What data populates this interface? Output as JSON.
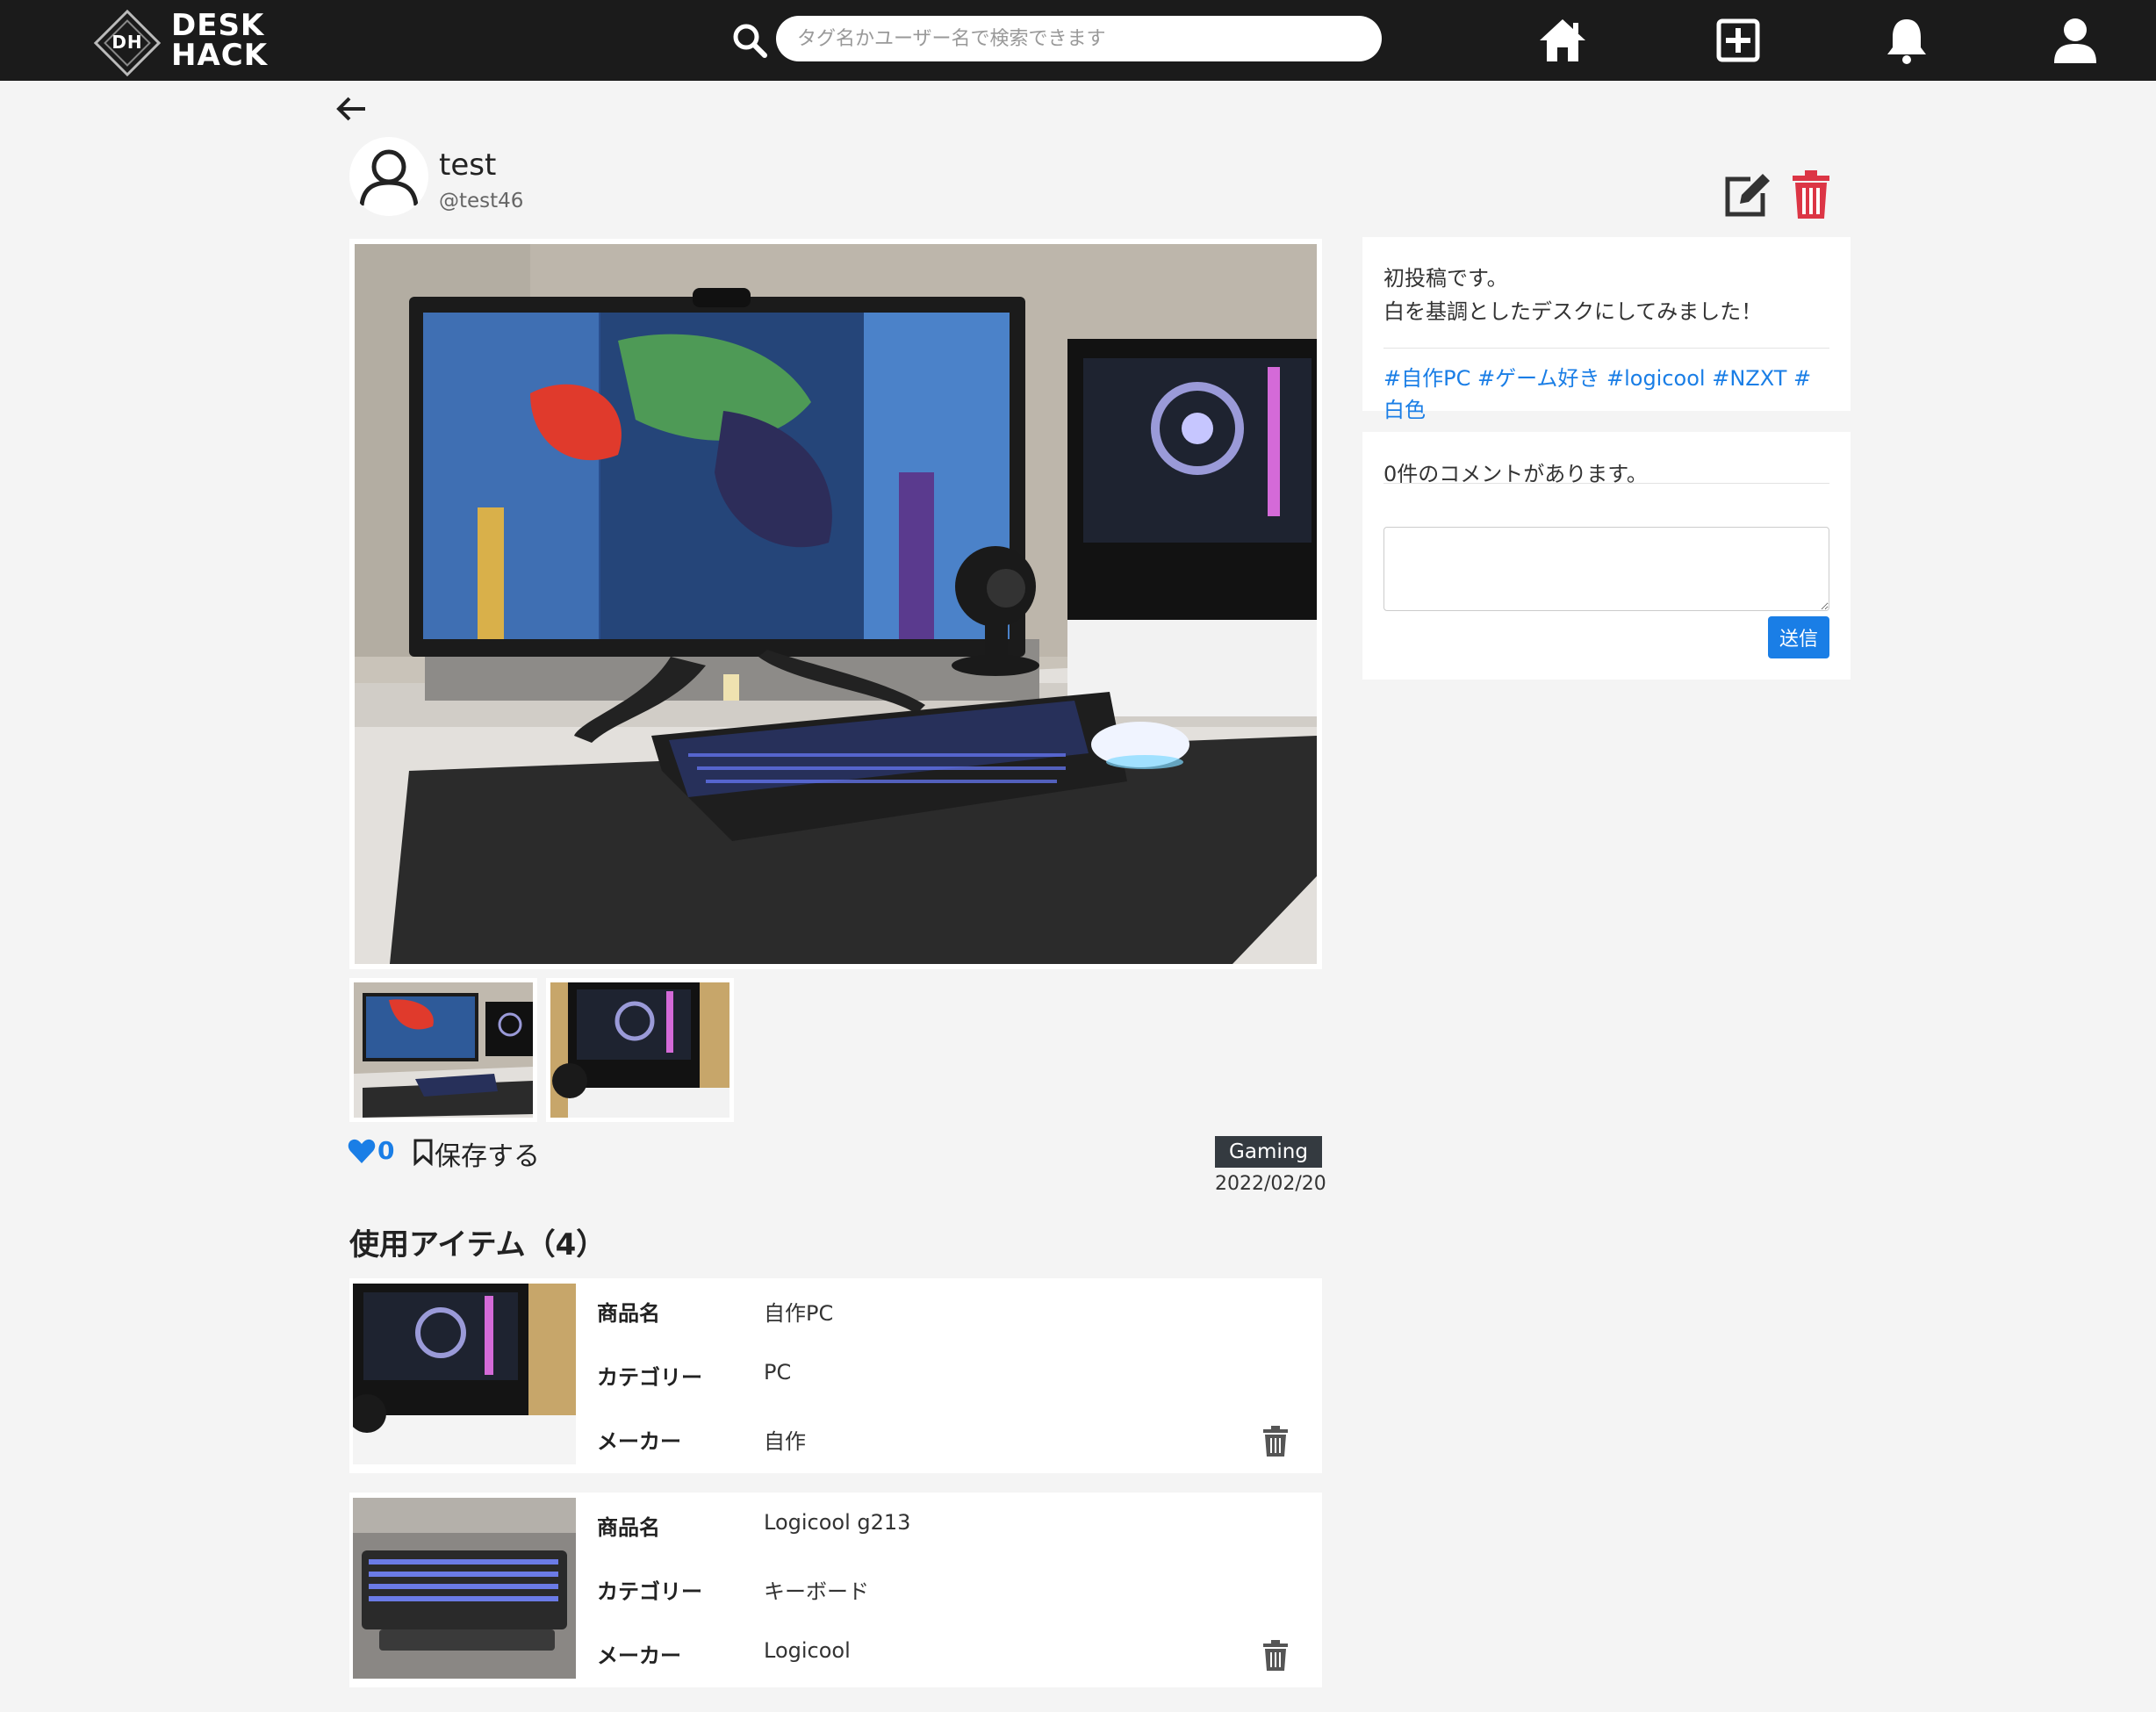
{
  "header": {
    "logo_mark": "DH",
    "logo_line1": "DESK",
    "logo_line2": "HACK",
    "search_placeholder": "タグ名かユーザー名で検索できます",
    "icons": [
      "search-icon",
      "home-icon",
      "add-post-icon",
      "bell-icon",
      "user-icon"
    ]
  },
  "post": {
    "username": "test",
    "handle": "@test46",
    "likes": "0",
    "save_label": "保存する",
    "category": "Gaming",
    "date": "2022/02/20",
    "thumbnail_count": 2
  },
  "description": {
    "lines": [
      "初投稿です。",
      "白を基調としたデスクにしてみました！"
    ],
    "hashtags": "#自作PC #ゲーム好き #logicool #NZXT #白色"
  },
  "comments": {
    "count_text": "0件のコメントがあります。",
    "submit_label": "送信"
  },
  "items": {
    "heading": "使用アイテム（4）",
    "labels": {
      "name": "商品名",
      "category": "カテゴリー",
      "maker": "メーカー"
    },
    "list": [
      {
        "name": "自作PC",
        "category": "PC",
        "maker": "自作"
      },
      {
        "name": "Logicool g213",
        "category": "キーボード",
        "maker": "Logicool"
      }
    ]
  },
  "colors": {
    "header_bg": "#1b1b1b",
    "accent_blue": "#1a7ee6",
    "delete_red": "#dc3545",
    "badge_dark": "#343a40"
  }
}
